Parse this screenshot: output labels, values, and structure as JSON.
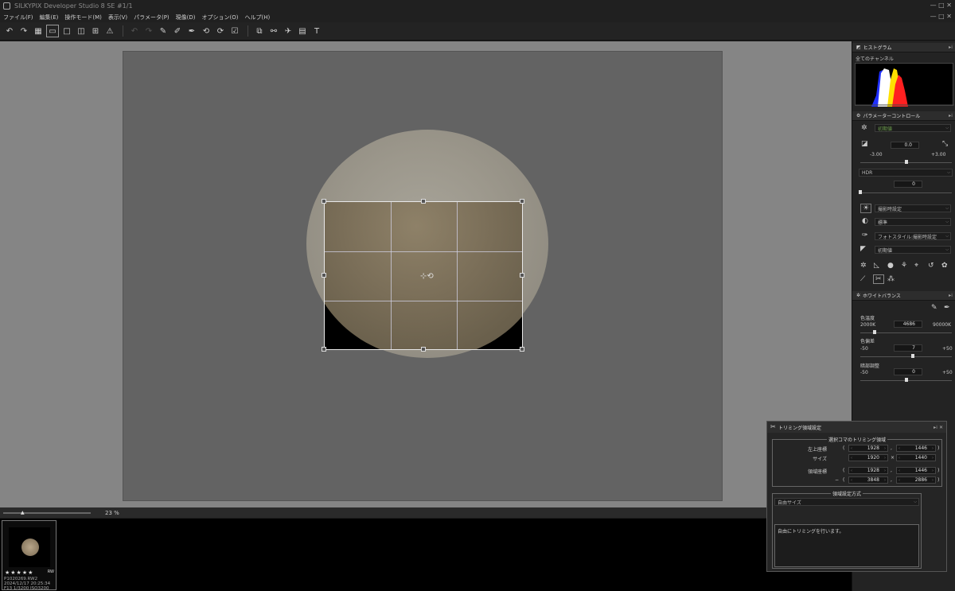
{
  "app": {
    "title": "SILKYPIX Developer Studio 8 SE    #1/1",
    "window_controls": "—  □  ✕",
    "menubar_controls": "—  □  ✕"
  },
  "menu": [
    "ファイル(F)",
    "編集(E)",
    "操作モード(M)",
    "表示(V)",
    "パラメータ(P)",
    "現像(D)",
    "オプション(O)",
    "ヘルプ(H)"
  ],
  "toolbar": {
    "icons": [
      "undo-icon",
      "redo-icon",
      "grid-view-icon",
      "filmstrip-view-icon",
      "single-view-icon",
      "compare-view-icon",
      "four-view-icon",
      "warning-icon",
      "undo2-icon",
      "redo2-icon",
      "stamp-icon",
      "paste-icon",
      "eyedropper-icon",
      "rotate-left-icon",
      "rotate-right-icon",
      "mark-icon",
      "develop-icon",
      "batch-icon",
      "satellite-icon",
      "preview-icon",
      "text-icon"
    ]
  },
  "viewer": {
    "zoom_value": "23",
    "zoom_unit": "%"
  },
  "thumbnail": {
    "stars": "★★★★★",
    "format": "RW",
    "filename": "P1020269.RW2",
    "datetime": "2024/12/17 20:25:34",
    "exif": "F13 1/3200 ISO3200"
  },
  "histogram": {
    "header": "ヒストグラム",
    "channel": "全てのチャンネル"
  },
  "param": {
    "header": "パラメーターコントロール",
    "preset": "初期値",
    "exposure_value": "0.0",
    "exposure_min": "-3.00",
    "exposure_max": "+3.00",
    "exposure_fraction": 0.5,
    "hdr_label": "HDR",
    "hdr_value": "0",
    "hdr_fraction": 0.0,
    "wb_preset": "撮影時設定",
    "tone_preset": "標準",
    "color_preset": "フォトスタイル:撮影時設定",
    "sharp_preset": "初期値"
  },
  "wb": {
    "header": "ホワイトバランス",
    "temp_label": "色温度",
    "temp_min": "2000K",
    "temp_value": "4686",
    "temp_max": "90000K",
    "temp_fraction": 0.16,
    "tint_label": "色偏差",
    "tint_min": "-50",
    "tint_value": "7",
    "tint_max": "+50",
    "tint_fraction": 0.57,
    "dark_label": "暗部調整",
    "dark_min": "-50",
    "dark_value": "0",
    "dark_max": "+50",
    "dark_fraction": 0.5
  },
  "trim": {
    "title": "トリミング領域設定",
    "group1_title": "選択コマのトリミング領域",
    "topleft_label": "左上座標",
    "topleft_x": "1928",
    "topleft_y": "1446",
    "size_label": "サイズ",
    "size_w": "1920",
    "size_h": "1440",
    "area_label": "領域座標",
    "area_x1": "1928",
    "area_y1": "1446",
    "area_x2": "3848",
    "area_y2": "2886",
    "paren_open": "(",
    "paren_close": ")",
    "comma": ",",
    "times": "×",
    "dash": "−",
    "group2_title": "領域設定方式",
    "method": "自由サイズ",
    "description": "自由にトリミングを行います。"
  }
}
